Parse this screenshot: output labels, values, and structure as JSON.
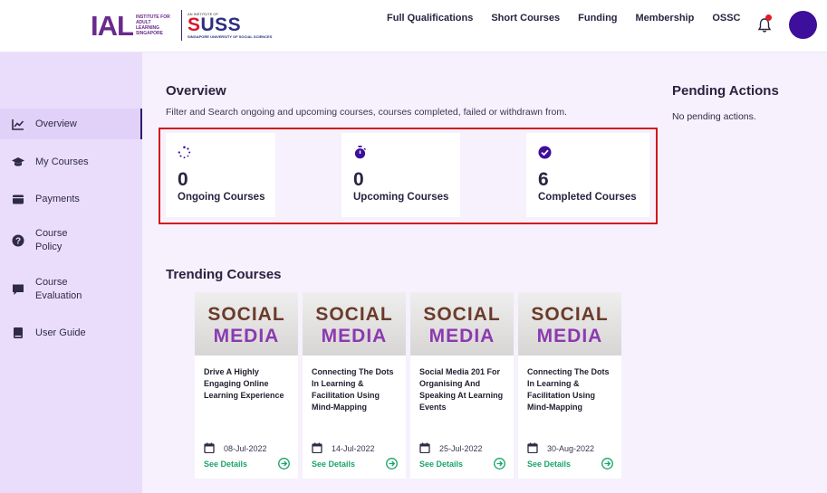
{
  "header": {
    "logo": {
      "ial": "IAL",
      "ial_sub": "INSTITUTE FOR ADULT LEARNING SINGAPORE",
      "suss_small": "AN INSTITUTE OF",
      "suss": "SUSS",
      "suss_sub": "SINGAPORE UNIVERSITY OF SOCIAL SCIENCES"
    },
    "nav": [
      "Full Qualifications",
      "Short Courses",
      "Funding",
      "Membership",
      "OSSC"
    ],
    "notification_icon": "bell-icon",
    "accent_color": "#3d0f9a"
  },
  "sidebar": {
    "items": [
      {
        "label": "Overview",
        "icon": "chart-line-icon",
        "active": true
      },
      {
        "label": "My Courses",
        "icon": "graduation-cap-icon",
        "active": false
      },
      {
        "label": "Payments",
        "icon": "wallet-icon",
        "active": false
      },
      {
        "label": "Course Policy",
        "icon": "question-circle-icon",
        "active": false
      },
      {
        "label": "Course Evaluation",
        "icon": "comment-icon",
        "active": false
      },
      {
        "label": "User Guide",
        "icon": "book-icon",
        "active": false
      }
    ]
  },
  "overview": {
    "title": "Overview",
    "subtitle": "Filter and Search ongoing and upcoming courses, courses completed, failed or withdrawn from.",
    "stats": [
      {
        "value": "0",
        "label": "Ongoing Courses",
        "icon": "spinner-icon"
      },
      {
        "value": "0",
        "label": "Upcoming Courses",
        "icon": "stopwatch-icon"
      },
      {
        "value": "6",
        "label": "Completed Courses",
        "icon": "check-circle-icon"
      }
    ]
  },
  "pending": {
    "title": "Pending Actions",
    "text": "No pending actions."
  },
  "trending": {
    "title": "Trending Courses",
    "image_text": {
      "line1": "SOCIAL",
      "line2": "MEDIA"
    },
    "link_label": "See Details",
    "courses": [
      {
        "title": "Drive A Highly Engaging Online Learning Experience",
        "date": "08-Jul-2022"
      },
      {
        "title": "Connecting The Dots In Learning & Facilitation Using Mind-Mapping",
        "date": "14-Jul-2022"
      },
      {
        "title": "Social Media 201 For Organising And Speaking At Learning Events",
        "date": "25-Jul-2022"
      },
      {
        "title": "Connecting The Dots In Learning & Facilitation Using Mind-Mapping",
        "date": "30-Aug-2022"
      }
    ]
  },
  "colors": {
    "highlight": "#d3161e",
    "link": "#1aa56a",
    "sidebar_bg": "#e9ddfb",
    "page_bg": "#f6f1fd"
  }
}
